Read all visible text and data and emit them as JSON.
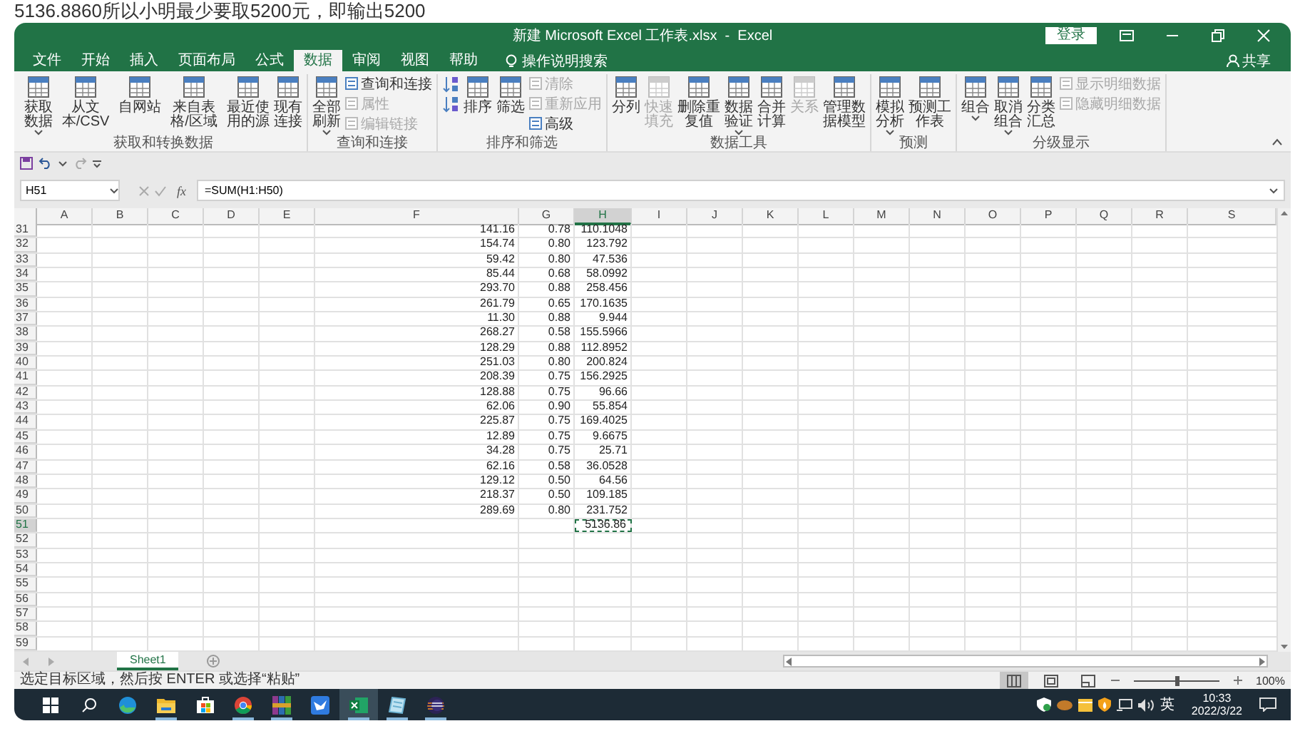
{
  "caption": "5136.8860所以小明最少要取5200元，即输出5200",
  "window": {
    "title": "新建 Microsoft Excel 工作表.xlsx  -  Excel",
    "login": "登录"
  },
  "menu_tabs": [
    {
      "label": "文件",
      "selected": false
    },
    {
      "label": "开始",
      "selected": false
    },
    {
      "label": "插入",
      "selected": false
    },
    {
      "label": "页面布局",
      "selected": false
    },
    {
      "label": "公式",
      "selected": false
    },
    {
      "label": "数据",
      "selected": true
    },
    {
      "label": "审阅",
      "selected": false
    },
    {
      "label": "视图",
      "selected": false
    },
    {
      "label": "帮助",
      "selected": false
    }
  ],
  "tell_me": "操作说明搜索",
  "share": "共享",
  "ribbon": [
    {
      "label": "获取和转换数据",
      "buttons": [
        {
          "label": "获取数据",
          "kind": "large",
          "disabled": false,
          "dropdown": true
        },
        {
          "label": "从文本/CSV",
          "kind": "large",
          "disabled": false,
          "dropdown": false
        },
        {
          "label": "自网站",
          "kind": "large",
          "disabled": false,
          "dropdown": false
        },
        {
          "label": "来自表格/区域",
          "kind": "large",
          "disabled": false,
          "dropdown": false
        },
        {
          "label": "最近使用的源",
          "kind": "large",
          "disabled": false,
          "dropdown": false
        },
        {
          "label": "现有连接",
          "kind": "large",
          "disabled": false,
          "dropdown": false
        }
      ]
    },
    {
      "label": "查询和连接",
      "buttons": [
        {
          "label": "全部刷新",
          "kind": "large",
          "disabled": false,
          "dropdown": true
        },
        {
          "label": "查询和连接",
          "kind": "small",
          "disabled": false,
          "dropdown": false
        },
        {
          "label": "属性",
          "kind": "small",
          "disabled": true,
          "dropdown": false
        },
        {
          "label": "编辑链接",
          "kind": "small",
          "disabled": true,
          "dropdown": false
        }
      ]
    },
    {
      "label": "排序和筛选",
      "buttons": [
        {
          "kind": "sortpair",
          "disabled": false
        },
        {
          "label": "排序",
          "kind": "large",
          "disabled": false,
          "dropdown": false
        },
        {
          "label": "筛选",
          "kind": "large",
          "disabled": false,
          "dropdown": false
        },
        {
          "label": "清除",
          "kind": "small",
          "disabled": true,
          "dropdown": false
        },
        {
          "label": "重新应用",
          "kind": "small",
          "disabled": true,
          "dropdown": false
        },
        {
          "label": "高级",
          "kind": "small",
          "disabled": false,
          "dropdown": false
        }
      ]
    },
    {
      "label": "数据工具",
      "buttons": [
        {
          "label": "分列",
          "kind": "large",
          "disabled": false,
          "dropdown": false
        },
        {
          "label": "快速填充",
          "kind": "large",
          "disabled": true,
          "dropdown": false
        },
        {
          "label": "删除重复值",
          "kind": "large",
          "disabled": false,
          "dropdown": false
        },
        {
          "label": "数据验证",
          "kind": "large",
          "disabled": false,
          "dropdown": true
        },
        {
          "label": "合并计算",
          "kind": "large",
          "disabled": false,
          "dropdown": false
        },
        {
          "label": "关系",
          "kind": "large",
          "disabled": true,
          "dropdown": false
        },
        {
          "label": "管理数据模型",
          "kind": "large",
          "disabled": false,
          "dropdown": false
        }
      ]
    },
    {
      "label": "预测",
      "buttons": [
        {
          "label": "模拟分析",
          "kind": "large",
          "disabled": false,
          "dropdown": true
        },
        {
          "label": "预测工作表",
          "kind": "large",
          "disabled": false,
          "dropdown": false
        }
      ]
    },
    {
      "label": "分级显示",
      "buttons": [
        {
          "label": "组合",
          "kind": "large",
          "disabled": false,
          "dropdown": true
        },
        {
          "label": "取消组合",
          "kind": "large",
          "disabled": false,
          "dropdown": true
        },
        {
          "label": "分类汇总",
          "kind": "large",
          "disabled": false,
          "dropdown": false
        },
        {
          "label": "显示明细数据",
          "kind": "small",
          "disabled": true,
          "dropdown": false
        },
        {
          "label": "隐藏明细数据",
          "kind": "small",
          "disabled": true,
          "dropdown": false
        }
      ]
    }
  ],
  "name_box": "H51",
  "fx": "fx",
  "formula": "=SUM(H1:H50)",
  "columns": [
    {
      "label": "A",
      "selected": false
    },
    {
      "label": "B",
      "selected": false
    },
    {
      "label": "C",
      "selected": false
    },
    {
      "label": "D",
      "selected": false
    },
    {
      "label": "E",
      "selected": false
    },
    {
      "label": "F",
      "selected": false
    },
    {
      "label": "G",
      "selected": false
    },
    {
      "label": "H",
      "selected": true
    },
    {
      "label": "I",
      "selected": false
    },
    {
      "label": "J",
      "selected": false
    },
    {
      "label": "K",
      "selected": false
    },
    {
      "label": "L",
      "selected": false
    },
    {
      "label": "M",
      "selected": false
    },
    {
      "label": "N",
      "selected": false
    },
    {
      "label": "O",
      "selected": false
    },
    {
      "label": "P",
      "selected": false
    },
    {
      "label": "Q",
      "selected": false
    },
    {
      "label": "R",
      "selected": false
    },
    {
      "label": "S",
      "selected": false
    }
  ],
  "rows": [
    {
      "number": "31",
      "f": "141.16",
      "g": "0.78",
      "h": "110.1048",
      "selected": false
    },
    {
      "number": "32",
      "f": "154.74",
      "g": "0.80",
      "h": "123.792",
      "selected": false
    },
    {
      "number": "33",
      "f": "59.42",
      "g": "0.80",
      "h": "47.536",
      "selected": false
    },
    {
      "number": "34",
      "f": "85.44",
      "g": "0.68",
      "h": "58.0992",
      "selected": false
    },
    {
      "number": "35",
      "f": "293.70",
      "g": "0.88",
      "h": "258.456",
      "selected": false
    },
    {
      "number": "36",
      "f": "261.79",
      "g": "0.65",
      "h": "170.1635",
      "selected": false
    },
    {
      "number": "37",
      "f": "11.30",
      "g": "0.88",
      "h": "9.944",
      "selected": false
    },
    {
      "number": "38",
      "f": "268.27",
      "g": "0.58",
      "h": "155.5966",
      "selected": false
    },
    {
      "number": "39",
      "f": "128.29",
      "g": "0.88",
      "h": "112.8952",
      "selected": false
    },
    {
      "number": "40",
      "f": "251.03",
      "g": "0.80",
      "h": "200.824",
      "selected": false
    },
    {
      "number": "41",
      "f": "208.39",
      "g": "0.75",
      "h": "156.2925",
      "selected": false
    },
    {
      "number": "42",
      "f": "128.88",
      "g": "0.75",
      "h": "96.66",
      "selected": false
    },
    {
      "number": "43",
      "f": "62.06",
      "g": "0.90",
      "h": "55.854",
      "selected": false
    },
    {
      "number": "44",
      "f": "225.87",
      "g": "0.75",
      "h": "169.4025",
      "selected": false
    },
    {
      "number": "45",
      "f": "12.89",
      "g": "0.75",
      "h": "9.6675",
      "selected": false
    },
    {
      "number": "46",
      "f": "34.28",
      "g": "0.75",
      "h": "25.71",
      "selected": false
    },
    {
      "number": "47",
      "f": "62.16",
      "g": "0.58",
      "h": "36.0528",
      "selected": false
    },
    {
      "number": "48",
      "f": "129.12",
      "g": "0.50",
      "h": "64.56",
      "selected": false
    },
    {
      "number": "49",
      "f": "218.37",
      "g": "0.50",
      "h": "109.185",
      "selected": false
    },
    {
      "number": "50",
      "f": "289.69",
      "g": "0.80",
      "h": "231.752",
      "selected": false
    },
    {
      "number": "51",
      "h": "5136.86",
      "selected": true
    },
    {
      "number": "52",
      "selected": false
    },
    {
      "number": "53",
      "selected": false
    },
    {
      "number": "54",
      "selected": false
    },
    {
      "number": "55",
      "selected": false
    },
    {
      "number": "56",
      "selected": false
    },
    {
      "number": "57",
      "selected": false
    },
    {
      "number": "58",
      "selected": false
    },
    {
      "number": "59",
      "selected": false
    }
  ],
  "sheet_tabs": [
    {
      "label": "Sheet1",
      "selected": true
    }
  ],
  "status_bar": {
    "message": "选定目标区域，然后按 ENTER 或选择“粘贴”",
    "views": [
      {
        "kind": "normal",
        "selected": true
      },
      {
        "kind": "layout",
        "selected": false
      },
      {
        "kind": "pagebreak",
        "selected": false
      }
    ],
    "zoom": {
      "level": 0.5,
      "reading": "100%"
    }
  },
  "taskbar": {
    "apps": [
      {
        "kind": "start",
        "running": false,
        "selected": false
      },
      {
        "kind": "search",
        "running": false,
        "selected": false
      },
      {
        "kind": "edge",
        "running": false,
        "selected": false
      },
      {
        "kind": "folder",
        "running": true,
        "selected": false
      },
      {
        "kind": "store",
        "running": false,
        "selected": false
      },
      {
        "kind": "chrome",
        "running": true,
        "selected": false
      },
      {
        "kind": "archive",
        "running": true,
        "selected": false
      },
      {
        "kind": "bird",
        "running": false,
        "selected": false
      },
      {
        "kind": "excel",
        "running": true,
        "selected": true
      },
      {
        "kind": "notepad",
        "running": true,
        "selected": false
      },
      {
        "kind": "eclipse",
        "running": true,
        "selected": false
      }
    ],
    "ime": "英",
    "time": "10:33",
    "date": "2022/3/22"
  }
}
